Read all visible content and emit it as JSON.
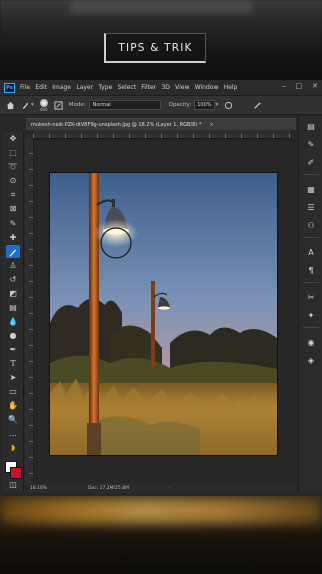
{
  "overlay": {
    "caption": "TIPS & TRIK"
  },
  "app": {
    "logo": "Ps",
    "menu": [
      "File",
      "Edit",
      "Image",
      "Layer",
      "Type",
      "Select",
      "Filter",
      "3D",
      "View",
      "Window",
      "Help"
    ],
    "window_controls": [
      "–",
      "□",
      "✕"
    ]
  },
  "options": {
    "brush_size": "400",
    "mode_label": "Mode:",
    "mode_value": "Normal",
    "opacity_label": "Opacity:",
    "opacity_value": "100%"
  },
  "document": {
    "tab_title": "mukesh-naik-PZK-dtV8F9g-unsplash.jpg @ 18.2% (Layer 1, RGB/8) *",
    "tab_close": "×",
    "zoom": "18.16%",
    "doc_info": "Doc: 17.2M/25.8M",
    "arrow": "›"
  },
  "tools": [
    "move-icon",
    "marquee-icon",
    "lasso-icon",
    "quick-select-icon",
    "crop-icon",
    "frame-icon",
    "eyedropper-icon",
    "healing-icon",
    "brush-icon",
    "stamp-icon",
    "history-brush-icon",
    "eraser-icon",
    "gradient-icon",
    "blur-icon",
    "dodge-icon",
    "pen-icon",
    "type-icon",
    "path-select-icon",
    "rectangle-icon",
    "hand-icon",
    "zoom-icon",
    "more-tools-icon"
  ],
  "colors": {
    "foreground": "#ffffff",
    "background": "#c8102e",
    "accent": "#1b6fd1"
  }
}
